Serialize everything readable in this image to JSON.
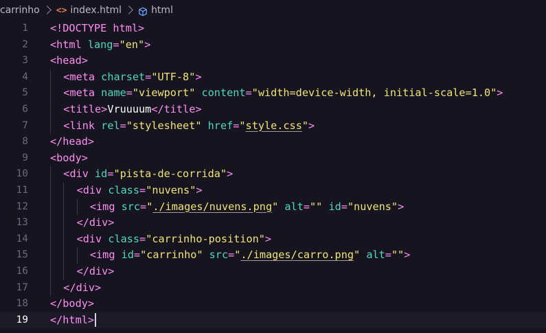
{
  "breadcrumb": {
    "folder": "carrinho",
    "file": "index.html",
    "symbol": "html",
    "file_icon_glyph": "<>"
  },
  "editor": {
    "current_line": 19,
    "lines": [
      {
        "n": "1",
        "indent": 0,
        "tokens": [
          [
            "tag",
            "<!DOCTYPE html>"
          ]
        ]
      },
      {
        "n": "2",
        "indent": 0,
        "tokens": [
          [
            "tag",
            "<html "
          ],
          [
            "attr",
            "lang"
          ],
          [
            "tag",
            "="
          ],
          [
            "str",
            "\"en\""
          ],
          [
            "tag",
            ">"
          ]
        ]
      },
      {
        "n": "3",
        "indent": 0,
        "tokens": [
          [
            "tag",
            "<head>"
          ]
        ]
      },
      {
        "n": "4",
        "indent": 1,
        "tokens": [
          [
            "tag",
            "<meta "
          ],
          [
            "attr",
            "charset"
          ],
          [
            "tag",
            "="
          ],
          [
            "str",
            "\"UTF-8\""
          ],
          [
            "tag",
            ">"
          ]
        ]
      },
      {
        "n": "5",
        "indent": 1,
        "tokens": [
          [
            "tag",
            "<meta "
          ],
          [
            "attr",
            "name"
          ],
          [
            "tag",
            "="
          ],
          [
            "str",
            "\"viewport\""
          ],
          [
            "tag",
            " "
          ],
          [
            "attr",
            "content"
          ],
          [
            "tag",
            "="
          ],
          [
            "str",
            "\"width=device-width, initial-scale=1.0\""
          ],
          [
            "tag",
            ">"
          ]
        ]
      },
      {
        "n": "6",
        "indent": 1,
        "tokens": [
          [
            "tag",
            "<title>"
          ],
          [
            "txt",
            "Vruuuum"
          ],
          [
            "tag",
            "</title>"
          ]
        ]
      },
      {
        "n": "7",
        "indent": 1,
        "tokens": [
          [
            "tag",
            "<link "
          ],
          [
            "attr",
            "rel"
          ],
          [
            "tag",
            "="
          ],
          [
            "str",
            "\"stylesheet\""
          ],
          [
            "tag",
            " "
          ],
          [
            "attr",
            "href"
          ],
          [
            "tag",
            "="
          ],
          [
            "str",
            "\""
          ],
          [
            "str link",
            "style.css"
          ],
          [
            "str",
            "\""
          ],
          [
            "tag",
            ">"
          ]
        ]
      },
      {
        "n": "8",
        "indent": 0,
        "tokens": [
          [
            "tag",
            "</head>"
          ]
        ]
      },
      {
        "n": "9",
        "indent": 0,
        "tokens": [
          [
            "tag",
            "<body>"
          ]
        ]
      },
      {
        "n": "10",
        "indent": 1,
        "tokens": [
          [
            "tag",
            "<div "
          ],
          [
            "attr",
            "id"
          ],
          [
            "tag",
            "="
          ],
          [
            "str",
            "\"pista-de-corrida\""
          ],
          [
            "tag",
            ">"
          ]
        ]
      },
      {
        "n": "11",
        "indent": 2,
        "tokens": [
          [
            "tag",
            "<div "
          ],
          [
            "attr",
            "class"
          ],
          [
            "tag",
            "="
          ],
          [
            "str",
            "\"nuvens\""
          ],
          [
            "tag",
            ">"
          ]
        ]
      },
      {
        "n": "12",
        "indent": 3,
        "tokens": [
          [
            "tag",
            "<img "
          ],
          [
            "attr",
            "src"
          ],
          [
            "tag",
            "="
          ],
          [
            "str",
            "\""
          ],
          [
            "str link",
            "./images/nuvens.png"
          ],
          [
            "str",
            "\""
          ],
          [
            "tag",
            " "
          ],
          [
            "attr",
            "alt"
          ],
          [
            "tag",
            "="
          ],
          [
            "str",
            "\"\""
          ],
          [
            "tag",
            " "
          ],
          [
            "attr",
            "id"
          ],
          [
            "tag",
            "="
          ],
          [
            "str",
            "\"nuvens\""
          ],
          [
            "tag",
            ">"
          ]
        ]
      },
      {
        "n": "13",
        "indent": 2,
        "tokens": [
          [
            "tag",
            "</div>"
          ]
        ]
      },
      {
        "n": "14",
        "indent": 2,
        "tokens": [
          [
            "tag",
            "<div "
          ],
          [
            "attr",
            "class"
          ],
          [
            "tag",
            "="
          ],
          [
            "str",
            "\"carrinho-position\""
          ],
          [
            "tag",
            ">"
          ]
        ]
      },
      {
        "n": "15",
        "indent": 3,
        "tokens": [
          [
            "tag",
            "<img "
          ],
          [
            "attr",
            "id"
          ],
          [
            "tag",
            "="
          ],
          [
            "str",
            "\"carrinho\""
          ],
          [
            "tag",
            " "
          ],
          [
            "attr",
            "src"
          ],
          [
            "tag",
            "="
          ],
          [
            "str",
            "\""
          ],
          [
            "str link",
            "./images/carro.png"
          ],
          [
            "str",
            "\""
          ],
          [
            "tag",
            " "
          ],
          [
            "attr",
            "alt"
          ],
          [
            "tag",
            "="
          ],
          [
            "str",
            "\"\""
          ],
          [
            "tag",
            ">"
          ]
        ]
      },
      {
        "n": "16",
        "indent": 2,
        "tokens": [
          [
            "tag",
            "</div>"
          ]
        ]
      },
      {
        "n": "17",
        "indent": 1,
        "tokens": [
          [
            "tag",
            "</div>"
          ]
        ]
      },
      {
        "n": "18",
        "indent": 0,
        "tokens": [
          [
            "tag",
            "</body>"
          ]
        ]
      },
      {
        "n": "19",
        "indent": 0,
        "tokens": [
          [
            "tag",
            "</html>"
          ]
        ]
      }
    ]
  }
}
